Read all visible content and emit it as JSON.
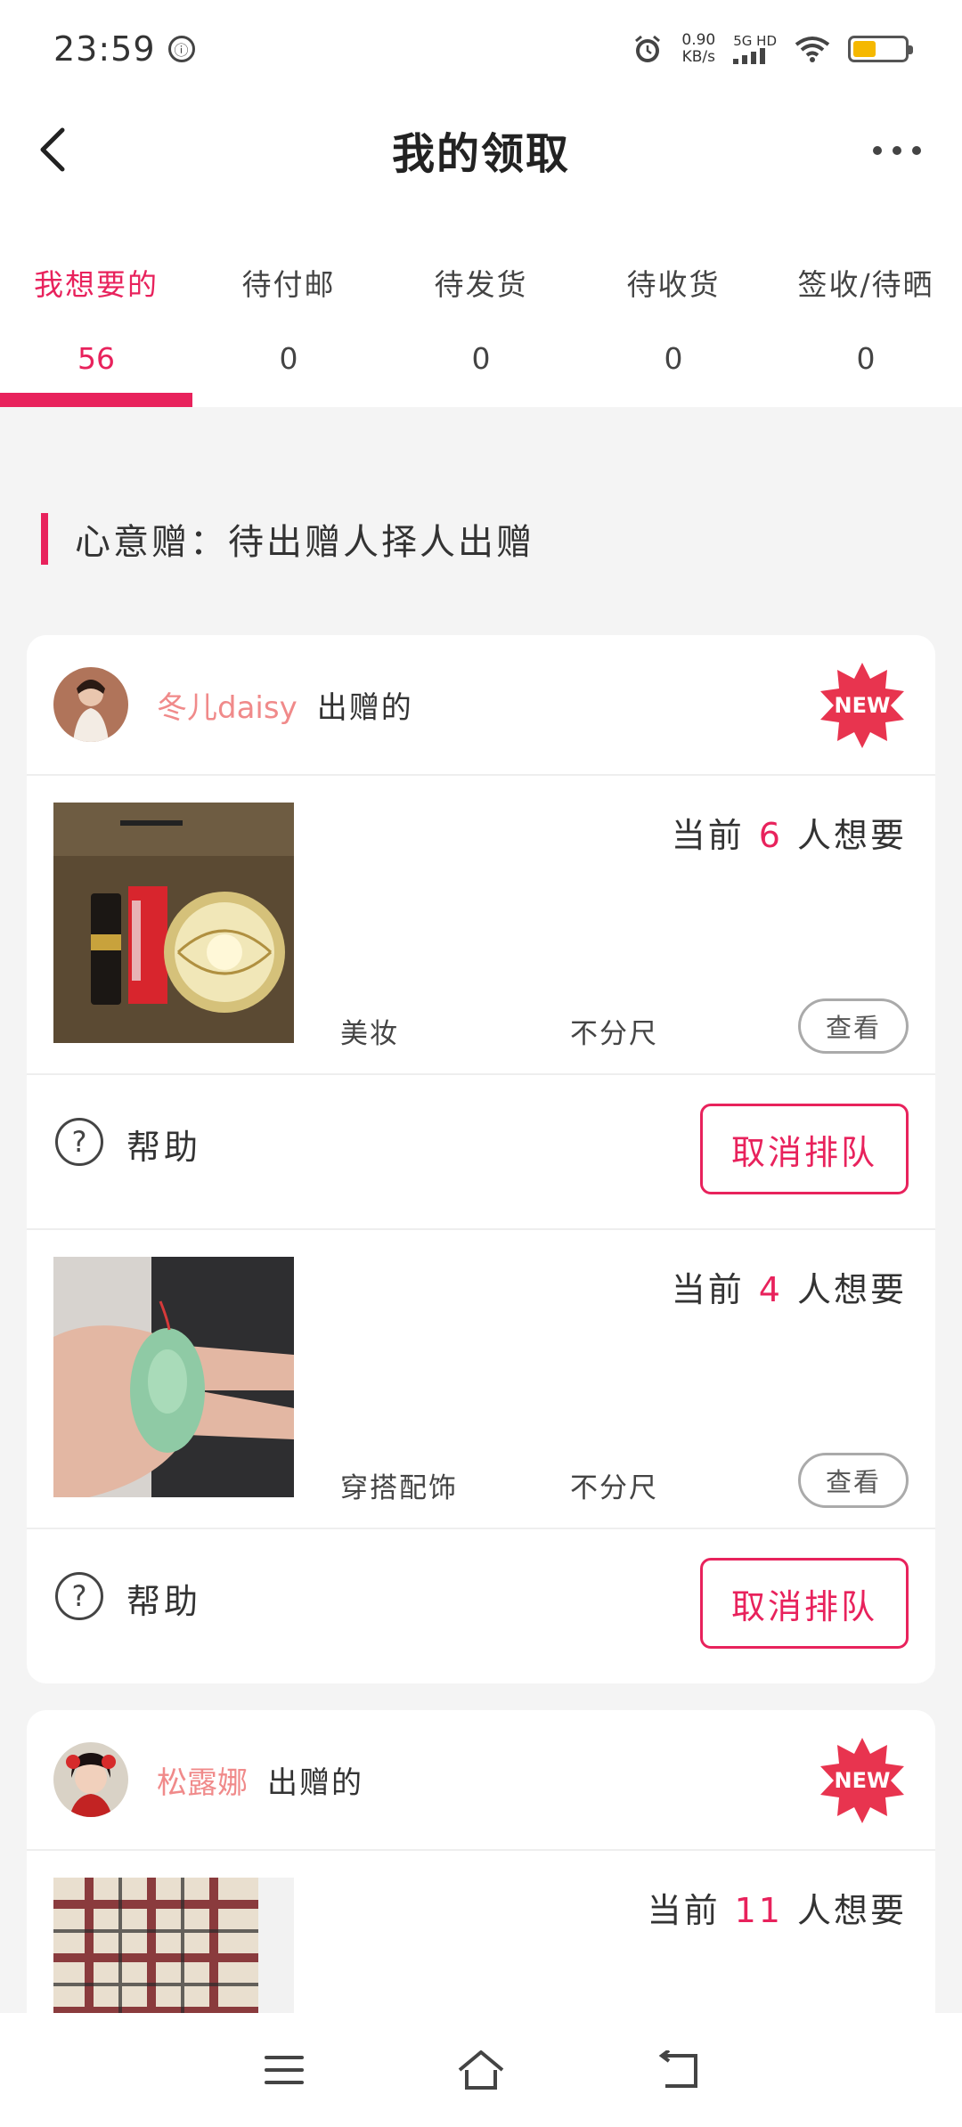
{
  "status_bar": {
    "time": "23:59",
    "notification_glyph": "ⓘ",
    "speed_value": "0.90",
    "speed_unit": "KB/s",
    "network_type": "5G HD",
    "battery_level": 0.45
  },
  "header": {
    "title": "我的领取"
  },
  "tabs": [
    {
      "label": "我想要的",
      "count": "56",
      "active": true
    },
    {
      "label": "待付邮",
      "count": "0",
      "active": false
    },
    {
      "label": "待发货",
      "count": "0",
      "active": false
    },
    {
      "label": "待收货",
      "count": "0",
      "active": false
    },
    {
      "label": "签收/待晒",
      "count": "0",
      "active": false
    }
  ],
  "section": {
    "title": "心意赠：待出赠人择人出赠"
  },
  "cards": [
    {
      "giver_name": "冬儿daisy",
      "giver_suffix": "出赠的",
      "badge": "NEW",
      "items": [
        {
          "want_prefix": "当前",
          "want_count": "6",
          "want_suffix": "人想要",
          "category": "美妆",
          "size": "不分尺",
          "view_label": "查看",
          "help_label": "帮助",
          "cancel_label": "取消排队"
        },
        {
          "want_prefix": "当前",
          "want_count": "4",
          "want_suffix": "人想要",
          "category": "穿搭配饰",
          "size": "不分尺",
          "view_label": "查看",
          "help_label": "帮助",
          "cancel_label": "取消排队"
        }
      ]
    },
    {
      "giver_name": "松露娜",
      "giver_suffix": "出赠的",
      "badge": "NEW",
      "items": [
        {
          "want_prefix": "当前",
          "want_count": "11",
          "want_suffix": "人想要"
        }
      ]
    }
  ],
  "colors": {
    "accent": "#e8225c",
    "giver_name": "#f08a8a",
    "background": "#f4f4f4"
  }
}
